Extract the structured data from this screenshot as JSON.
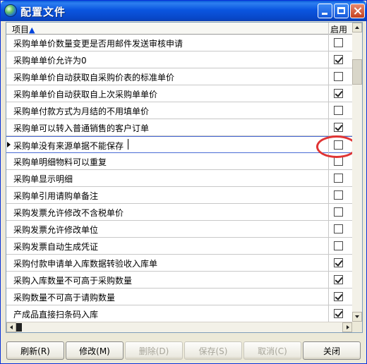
{
  "window": {
    "title": "配置文件",
    "icon": "globe-icon"
  },
  "grid": {
    "header": {
      "item_label": "项目",
      "sort_indicator": "▲",
      "enable_label": "启用"
    },
    "rows": [
      {
        "label": "采购单单价数量变更是否用邮件发送审核申请",
        "enabled": false
      },
      {
        "label": "采购单单价允许为0",
        "enabled": true
      },
      {
        "label": "采购单单价自动获取自采购价表的标准单价",
        "enabled": false
      },
      {
        "label": "采购单单价自动获取自上次采购单单价",
        "enabled": true
      },
      {
        "label": "采购单付款方式为月结的不用填单价",
        "enabled": false
      },
      {
        "label": "采购单可以转入普通销售的客户订单",
        "enabled": true
      },
      {
        "label": "采购单没有来源单据不能保存",
        "enabled": false,
        "current": true
      },
      {
        "label": "采购单明细物料可以重复",
        "enabled": false
      },
      {
        "label": "采购单显示明细",
        "enabled": false
      },
      {
        "label": "采购单引用请购单备注",
        "enabled": false
      },
      {
        "label": "采购发票允许修改不含税单价",
        "enabled": false
      },
      {
        "label": "采购发票允许修改单位",
        "enabled": false
      },
      {
        "label": "采购发票自动生成凭证",
        "enabled": false
      },
      {
        "label": "采购付款申请单入库数据转验收入库单",
        "enabled": true
      },
      {
        "label": "采购入库数量不可高于采购数量",
        "enabled": true
      },
      {
        "label": "采购数量不可高于请购数量",
        "enabled": true
      },
      {
        "label": "产成品直接扫条码入库",
        "enabled": true
      }
    ]
  },
  "buttons": {
    "refresh": "刷新(R)",
    "modify": "修改(M)",
    "delete": "删除(D)",
    "save": "保存(S)",
    "cancel": "取消(C)",
    "close": "关闭"
  },
  "colors": {
    "titlebar": "#0b56e0",
    "annotation": "#e03434"
  }
}
